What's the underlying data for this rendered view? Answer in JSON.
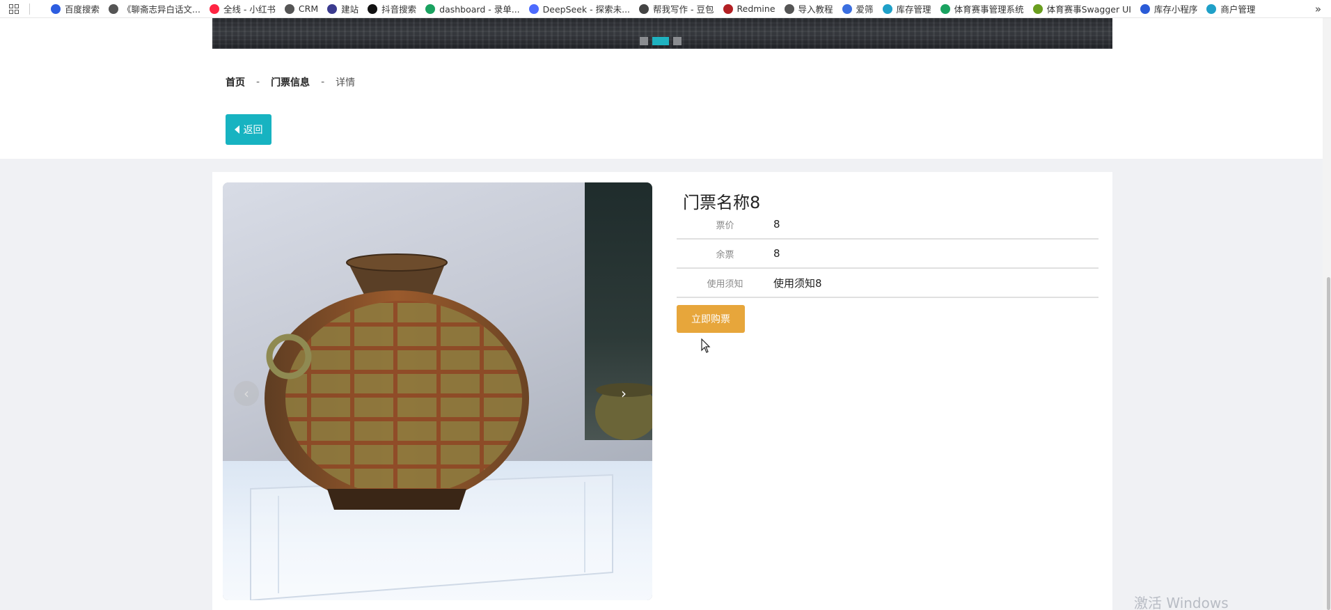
{
  "bookmarks": {
    "items": [
      {
        "label": "百度搜索",
        "icon": "baidu-icon",
        "color": "#2d5de0"
      },
      {
        "label": "《聊斋志异白话文...",
        "icon": "globe-icon",
        "color": "#555555"
      },
      {
        "label": "全线 - 小红书",
        "icon": "xiaohongshu-icon",
        "color": "#ff2442"
      },
      {
        "label": "CRM",
        "icon": "globe-icon",
        "color": "#555555"
      },
      {
        "label": "建站",
        "icon": "site-icon",
        "color": "#3b3b8f"
      },
      {
        "label": "抖音搜索",
        "icon": "tiktok-icon",
        "color": "#111111"
      },
      {
        "label": "dashboard - 录单...",
        "icon": "leaf-icon",
        "color": "#1aa260"
      },
      {
        "label": "DeepSeek - 探索未...",
        "icon": "deepseek-icon",
        "color": "#4d6bfe"
      },
      {
        "label": "帮我写作 - 豆包",
        "icon": "doubao-icon",
        "color": "#444444"
      },
      {
        "label": "Redmine",
        "icon": "redmine-icon",
        "color": "#b32024"
      },
      {
        "label": "导入教程",
        "icon": "globe-icon",
        "color": "#555555"
      },
      {
        "label": "爱筛",
        "icon": "aishai-icon",
        "color": "#3b6fe0"
      },
      {
        "label": "库存管理",
        "icon": "app-icon",
        "color": "#1fa0c8"
      },
      {
        "label": "体育赛事管理系统",
        "icon": "leaf-icon",
        "color": "#1aa260"
      },
      {
        "label": "体育赛事Swagger UI",
        "icon": "swagger-icon",
        "color": "#6a9e1f"
      },
      {
        "label": "库存小程序",
        "icon": "mountain-icon",
        "color": "#2a5bd7"
      },
      {
        "label": "商户管理",
        "icon": "app-icon",
        "color": "#1fa0c8"
      }
    ],
    "more": "»"
  },
  "breadcrumb": {
    "home": "首页",
    "section": "门票信息",
    "current": "详情",
    "separator": "-"
  },
  "back_button": {
    "label": "返回"
  },
  "ticket": {
    "title": "门票名称8",
    "rows": [
      {
        "label": "票价",
        "value": "8"
      },
      {
        "label": "余票",
        "value": "8"
      },
      {
        "label": "使用须知",
        "value": "使用须知8"
      }
    ],
    "buy_label": "立即购票"
  },
  "gallery": {
    "prev": "‹",
    "next": "›"
  },
  "banner": {
    "active_dot": 1,
    "dot_count": 3
  },
  "watermark": "激活 Windows",
  "colors": {
    "accent": "#17b3c1",
    "buy": "#e7a63b"
  }
}
